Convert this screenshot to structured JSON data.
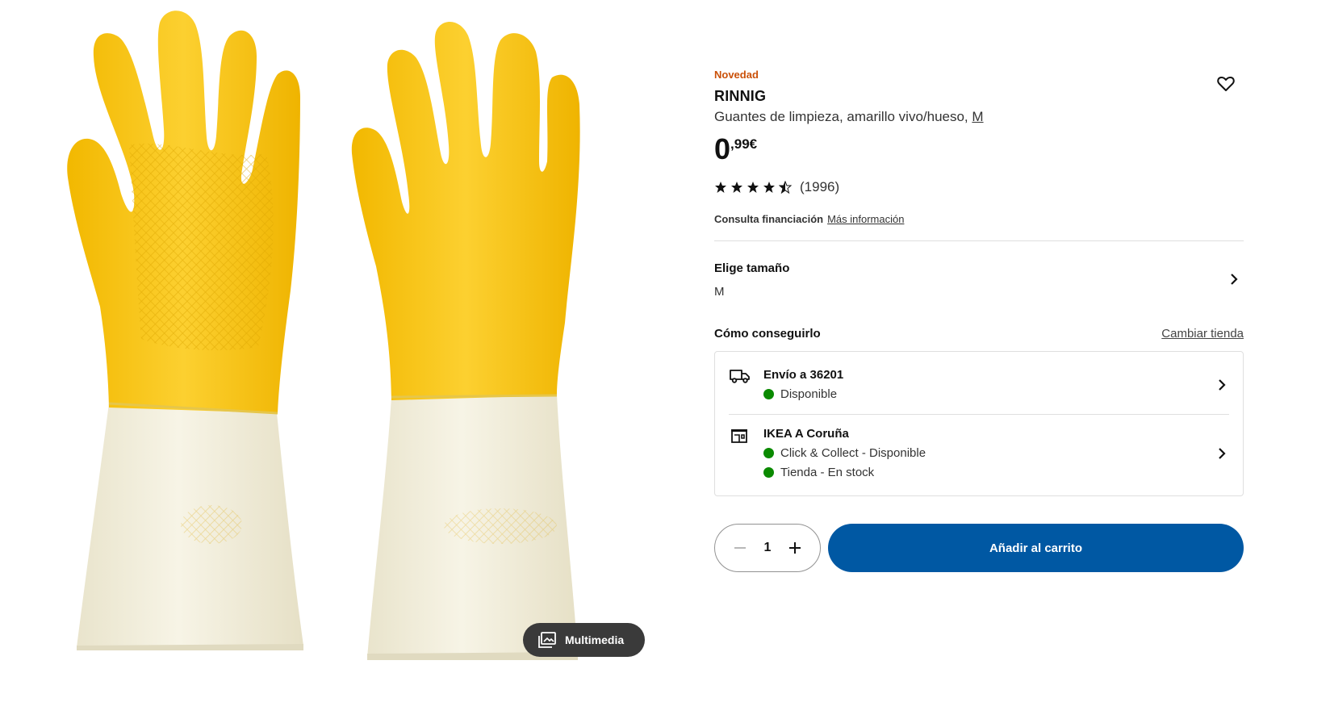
{
  "product": {
    "badge": "Novedad",
    "name": "RINNIG",
    "description": "Guantes de limpieza, amarillo vivo/hueso, ",
    "size_link": "M",
    "price_int": "0",
    "price_dec": ",99€",
    "rating_value": 4.5,
    "rating_count": "(1996)"
  },
  "financing": {
    "label": "Consulta financiación",
    "link": "Más información"
  },
  "size": {
    "title": "Elige tamaño",
    "value": "M"
  },
  "availability": {
    "title": "Cómo conseguirlo",
    "change_store": "Cambiar tienda",
    "delivery": {
      "title": "Envío a 36201",
      "status": "Disponible"
    },
    "store": {
      "title": "IKEA A Coruña",
      "status_1": "Click & Collect - Disponible",
      "status_2": "Tienda - En stock"
    }
  },
  "cart": {
    "quantity": "1",
    "add_label": "Añadir al carrito"
  },
  "media": {
    "button_label": "Multimedia"
  },
  "colors": {
    "accent": "#0058a3",
    "badge": "#ca5008",
    "available": "#0a8a00",
    "glove_yellow": "#f5c31a",
    "glove_cuff": "#f3efdc"
  },
  "icons": {
    "favorite": "heart-icon",
    "delivery": "truck-icon",
    "store": "store-icon",
    "chevron": "chevron-right-icon",
    "media": "gallery-icon"
  }
}
